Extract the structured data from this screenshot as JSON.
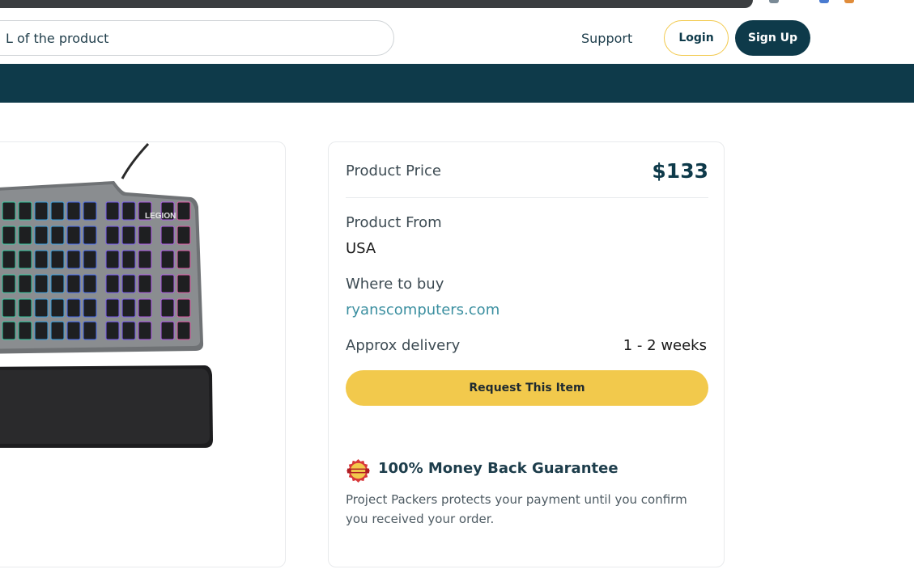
{
  "header": {
    "search_text": "L of the product",
    "support_label": "Support",
    "login_label": "Login",
    "signup_label": "Sign Up"
  },
  "product": {
    "price_label": "Product Price",
    "price_value": "$133",
    "from_label": "Product From",
    "from_value": "USA",
    "where_label": "Where to buy",
    "where_value": "ryanscomputers.com",
    "delivery_label": "Approx delivery",
    "delivery_value": "1 - 2 weeks",
    "request_label": "Request This Item"
  },
  "guarantee": {
    "title": "100% Money Back Guarantee",
    "text": "Project Packers protects your payment until you confirm you received your order.",
    "badge_icon": "money-back-badge-icon"
  },
  "image": {
    "brand_text": "LEGION",
    "icon": "keyboard-product-image"
  },
  "colors": {
    "brand_dark": "#0e3a4a",
    "accent_yellow": "#f2c94c",
    "link": "#3b8fa0"
  }
}
